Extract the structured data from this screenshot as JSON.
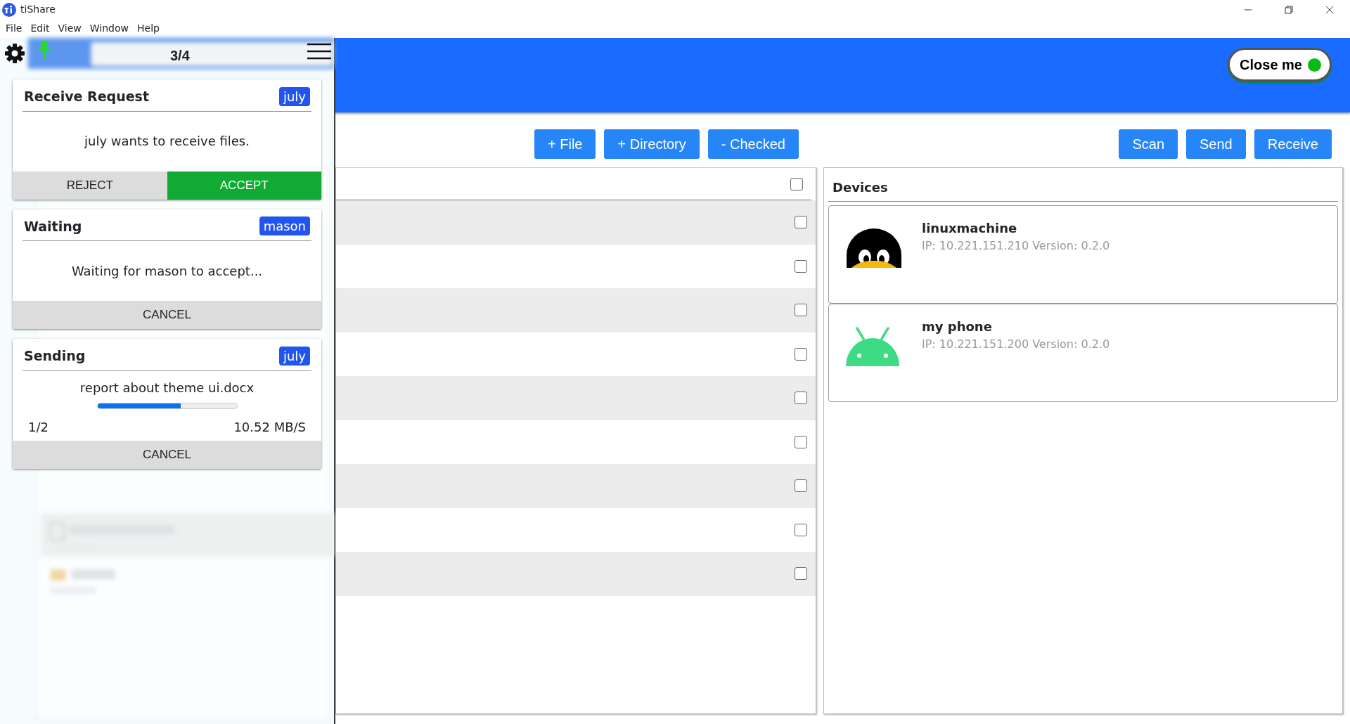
{
  "window": {
    "title": "tiShare"
  },
  "menu": [
    "File",
    "Edit",
    "View",
    "Window",
    "Help"
  ],
  "header": {
    "close_button": {
      "label": "Close me",
      "on": true
    }
  },
  "overlay": {
    "counter": "3/4",
    "pinned": true,
    "jobs": [
      {
        "kind": "request",
        "title": "Receive Request",
        "peer": "july",
        "message": "july wants to receive files.",
        "buttons": [
          {
            "label": "REJECT",
            "kind": "secondary"
          },
          {
            "label": "ACCEPT",
            "kind": "primary"
          }
        ]
      },
      {
        "kind": "waiting",
        "title": "Waiting",
        "peer": "mason",
        "message": "Waiting for mason to accept...",
        "buttons": [
          {
            "label": "CANCEL",
            "kind": "secondary"
          }
        ]
      },
      {
        "kind": "sending",
        "title": "Sending",
        "peer": "july",
        "file": "report about theme ui.docx",
        "level": 0.6,
        "count": "1/2",
        "speed": "10.52 MB/S",
        "buttons": [
          {
            "label": "CANCEL",
            "kind": "secondary"
          }
        ]
      }
    ]
  },
  "file_actions": [
    "+ File",
    "+ Directory",
    "- Checked"
  ],
  "device_actions": [
    "Scan",
    "Send",
    "Receive"
  ],
  "file_list": {
    "header_checked": false,
    "rows": [
      {
        "checked": false
      },
      {
        "checked": false
      },
      {
        "checked": false
      },
      {
        "checked": false
      },
      {
        "checked": false
      },
      {
        "checked": false
      },
      {
        "checked": false
      },
      {
        "checked": false
      },
      {
        "checked": false
      }
    ]
  },
  "devices": {
    "title": "Devices",
    "items": [
      {
        "kind": "linux",
        "name": "linuxmachine",
        "info": "IP: 10.221.151.210 Version: 0.2.0"
      },
      {
        "kind": "android",
        "name": "my phone",
        "info": "IP: 10.221.151.200 Version: 0.2.0"
      }
    ]
  }
}
